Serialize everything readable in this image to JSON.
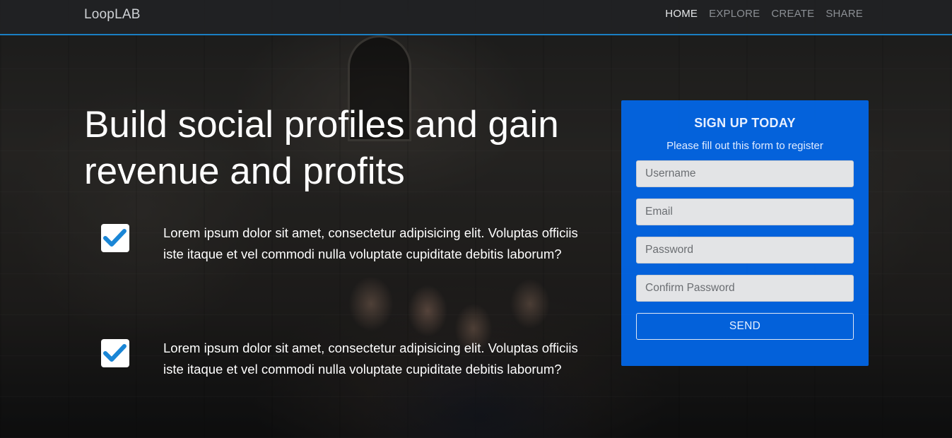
{
  "navbar": {
    "brand": "LoopLAB",
    "items": [
      {
        "label": "HOME",
        "active": true
      },
      {
        "label": "EXPLORE",
        "active": false
      },
      {
        "label": "CREATE",
        "active": false
      },
      {
        "label": "SHARE",
        "active": false
      }
    ]
  },
  "hero": {
    "headline": "Build social profiles and gain revenue and profits",
    "features": [
      {
        "icon": "checkmark-icon",
        "text": "Lorem ipsum dolor sit amet, consectetur adipisicing elit. Voluptas officiis iste itaque et vel commodi nulla voluptate cupiditate debitis laborum?"
      },
      {
        "icon": "checkmark-icon",
        "text": "Lorem ipsum dolor sit amet, consectetur adipisicing elit. Voluptas officiis iste itaque et vel commodi nulla voluptate cupiditate debitis laborum?"
      }
    ]
  },
  "signup": {
    "title": "SIGN UP TODAY",
    "subtitle": "Please fill out this form to register",
    "username_placeholder": "Username",
    "email_placeholder": "Email",
    "password_placeholder": "Password",
    "confirm_password_placeholder": "Confirm Password",
    "send_label": "SEND"
  },
  "colors": {
    "accent": "#1a7fc4",
    "form_background": "#0364e1",
    "checkmark": "#1a86d6"
  }
}
